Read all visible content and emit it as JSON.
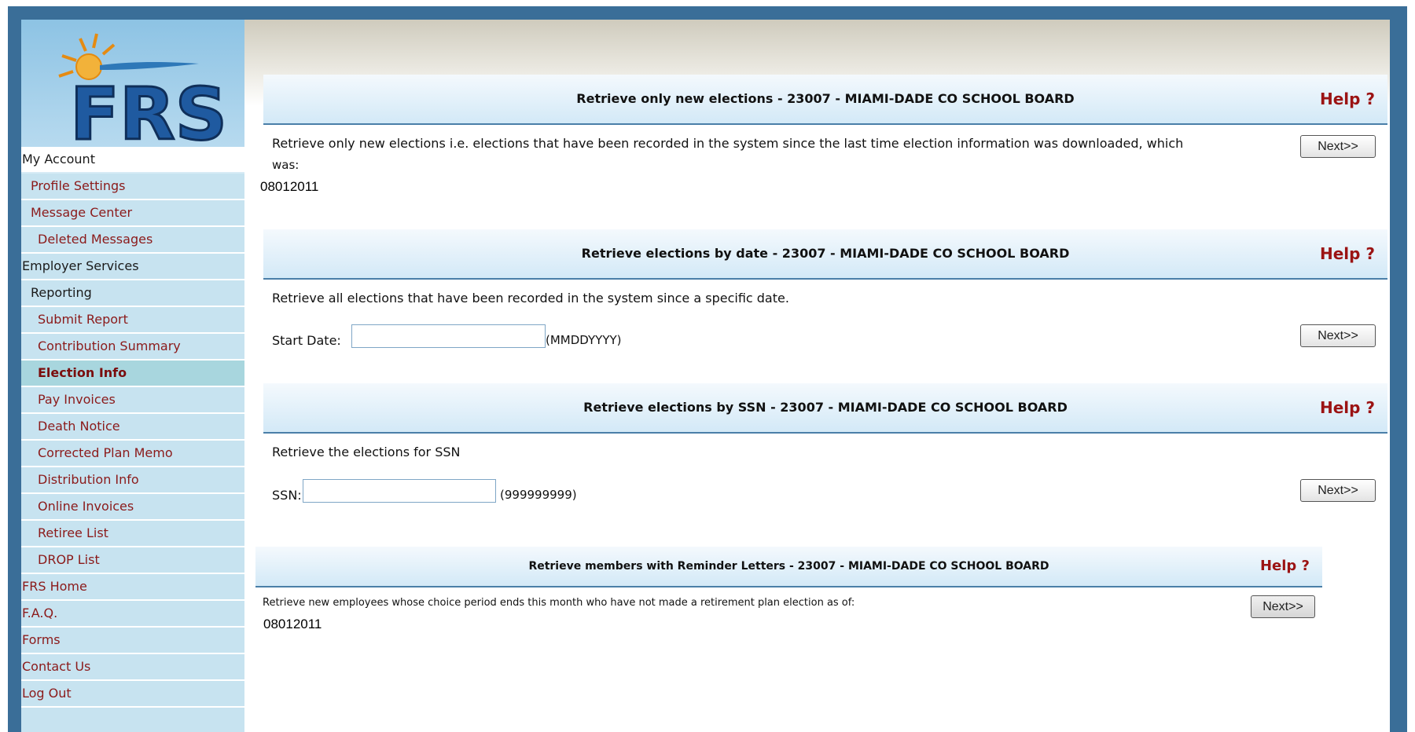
{
  "logo": {
    "text": "FRS"
  },
  "sidebar": {
    "items": [
      {
        "label": "My Account"
      },
      {
        "label": "Profile Settings"
      },
      {
        "label": "Message Center"
      },
      {
        "label": "Deleted Messages"
      },
      {
        "label": "Employer Services"
      },
      {
        "label": "Reporting"
      },
      {
        "label": "Submit Report"
      },
      {
        "label": "Contribution Summary"
      },
      {
        "label": "Election Info"
      },
      {
        "label": "Pay Invoices"
      },
      {
        "label": "Death Notice"
      },
      {
        "label": "Corrected Plan Memo"
      },
      {
        "label": "Distribution Info"
      },
      {
        "label": "Online Invoices"
      },
      {
        "label": "Retiree List"
      },
      {
        "label": "DROP List"
      },
      {
        "label": "FRS Home"
      },
      {
        "label": "F.A.Q."
      },
      {
        "label": "Forms"
      },
      {
        "label": "Contact Us"
      },
      {
        "label": "Log Out"
      }
    ]
  },
  "panels": {
    "new_elections": {
      "title": "Retrieve only new elections - 23007 - MIAMI-DADE CO SCHOOL BOARD",
      "help": "Help ?",
      "desc_line1": "Retrieve only new elections i.e. elections that have been recorded in the system since the last time election information was downloaded, which",
      "desc_line2": "was:",
      "date": "08012011",
      "next": "Next>>"
    },
    "by_date": {
      "title": "Retrieve elections by date - 23007 - MIAMI-DADE CO SCHOOL BOARD",
      "help": "Help ?",
      "desc": "Retrieve all elections that have been recorded in the system since a specific date.",
      "field_label": "Start Date:",
      "field_value": "",
      "format_hint": "(MMDDYYYY)",
      "next": "Next>>"
    },
    "by_ssn": {
      "title": "Retrieve elections by SSN - 23007 - MIAMI-DADE CO SCHOOL BOARD",
      "help": "Help ?",
      "desc": "Retrieve the elections for SSN",
      "field_label": "SSN:",
      "field_value": "",
      "format_hint": "(999999999)",
      "next": "Next>>"
    },
    "reminder": {
      "title": "Retrieve members with Reminder Letters - 23007 - MIAMI-DADE CO SCHOOL BOARD",
      "help": "Help ?",
      "desc": "Retrieve new employees whose choice period ends this month who have not made a retirement plan election as of:",
      "date": "08012011",
      "next": "Next>>"
    }
  }
}
